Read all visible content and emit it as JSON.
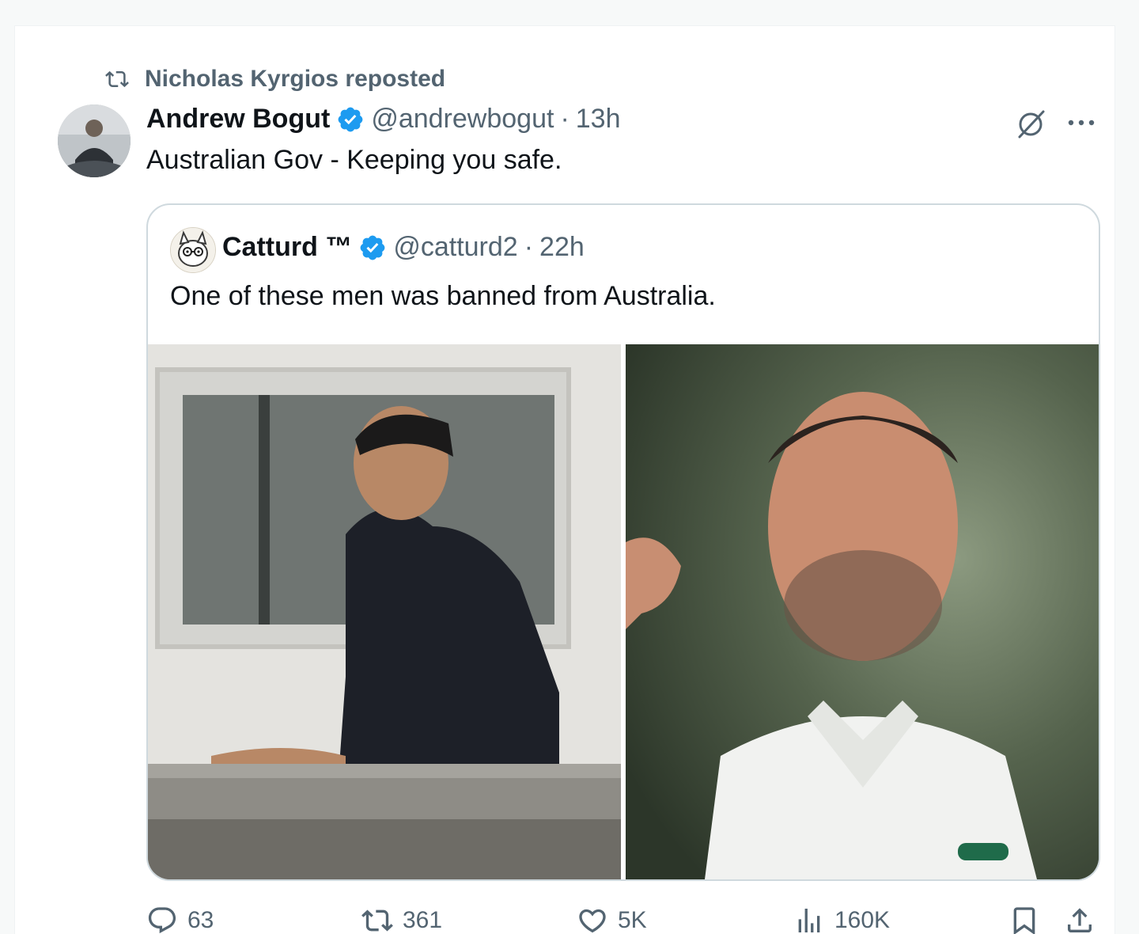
{
  "repost_banner": {
    "text": "Nicholas Kyrgios reposted"
  },
  "tweet": {
    "author_name": "Andrew Bogut",
    "handle": "@andrewbogut",
    "separator": "·",
    "time": "13h",
    "text": "Australian Gov - Keeping you safe."
  },
  "quoted_tweet": {
    "author_name": "Catturd ™",
    "handle": "@catturd2",
    "separator": "·",
    "time": "22h",
    "text": "One of these men was banned from Australia."
  },
  "actions": {
    "replies": "63",
    "reposts": "361",
    "likes": "5K",
    "views": "160K"
  },
  "colors": {
    "verified": "#1d9bf0",
    "muted": "#536471",
    "text": "#0f1419",
    "border": "#cfd9de"
  }
}
